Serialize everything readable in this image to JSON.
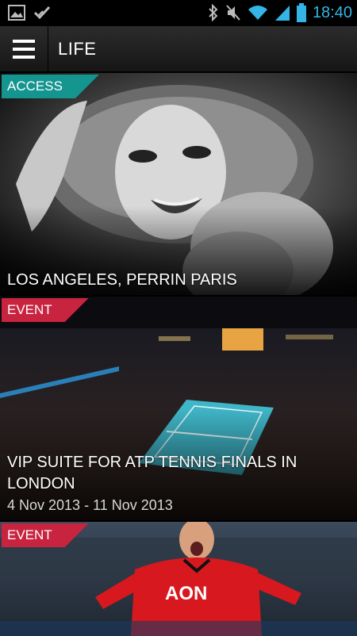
{
  "status_bar": {
    "time": "18:40",
    "left_icons": [
      "image-icon",
      "check-icon"
    ],
    "right_icons": [
      "bluetooth-icon",
      "mute-icon",
      "wifi-icon",
      "signal-icon",
      "battery-icon"
    ]
  },
  "app_bar": {
    "title": "LIFE"
  },
  "colors": {
    "access_tag": "#14958f",
    "event_tag": "#c8233f",
    "time_text": "#34b5e5"
  },
  "cards": [
    {
      "tag": "ACCESS",
      "title": "LOS ANGELES, PERRIN PARIS",
      "date": ""
    },
    {
      "tag": "EVENT",
      "title": "VIP SUITE FOR ATP TENNIS FINALS IN LONDON",
      "date": "4 Nov 2013 - 11 Nov 2013"
    },
    {
      "tag": "EVENT",
      "title": "",
      "date": ""
    }
  ],
  "images": {
    "card1": "black-and-white portrait of woman in fur hat",
    "card2": "indoor tennis arena with crowd",
    "card3": "football player in red jersey celebrating",
    "jersey_text": "AON"
  }
}
